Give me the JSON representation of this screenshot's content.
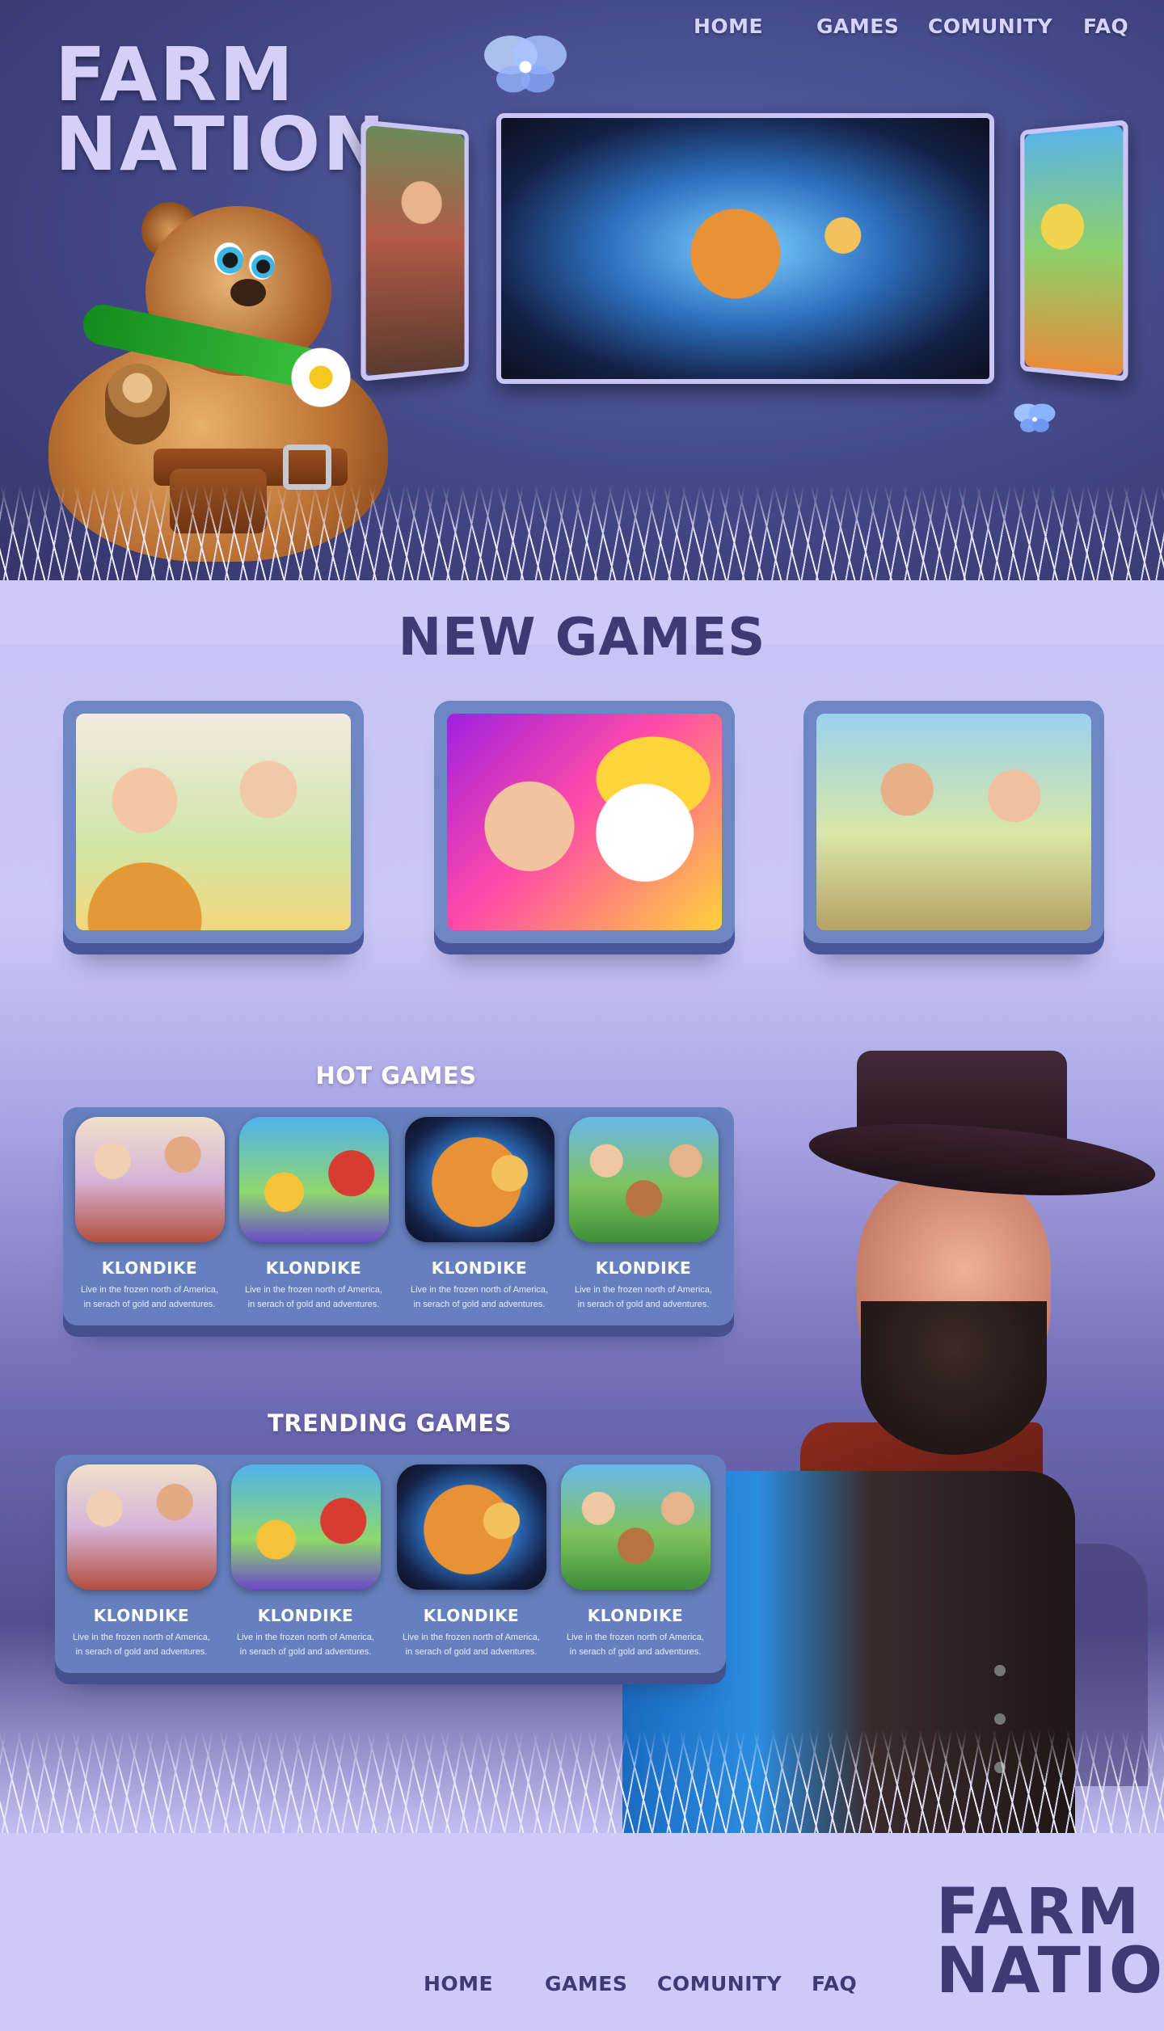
{
  "brand": {
    "line1": "FARM",
    "line2": "NATION"
  },
  "nav": {
    "home": "HOME",
    "games": "GAMES",
    "community": "COMUNITY",
    "faq": "FAQ"
  },
  "new_games": {
    "title": "NEW GAMES"
  },
  "hot_games": {
    "title": "HOT GAMES",
    "items": [
      {
        "name": "KLONDIKE",
        "desc_line1": "Live in the frozen north of America,",
        "desc_line2": "in serach of gold and adventures."
      },
      {
        "name": "KLONDIKE",
        "desc_line1": "Live in the frozen north of America,",
        "desc_line2": "in serach of gold and adventures."
      },
      {
        "name": "KLONDIKE",
        "desc_line1": "Live in the frozen north of America,",
        "desc_line2": "in serach of gold and adventures."
      },
      {
        "name": "KLONDIKE",
        "desc_line1": "Live in the frozen north of America,",
        "desc_line2": "in serach of gold and adventures."
      }
    ]
  },
  "trending_games": {
    "title": "TRENDING GAMES",
    "items": [
      {
        "name": "KLONDIKE",
        "desc_line1": "Live in the frozen north of America,",
        "desc_line2": "in serach of gold and adventures."
      },
      {
        "name": "KLONDIKE",
        "desc_line1": "Live in the frozen north of America,",
        "desc_line2": "in serach of gold and adventures."
      },
      {
        "name": "KLONDIKE",
        "desc_line1": "Live in the frozen north of America,",
        "desc_line2": "in serach of gold and adventures."
      },
      {
        "name": "KLONDIKE",
        "desc_line1": "Live in the frozen north of America,",
        "desc_line2": "in serach of gold and adventures."
      }
    ]
  },
  "footer": {
    "nav": {
      "home": "HOME",
      "games": "GAMES",
      "community": "COMUNITY",
      "faq": "FAQ"
    },
    "brand": {
      "line1": "FARM",
      "line2": "NATION"
    }
  },
  "colors": {
    "header_bg": "#434785",
    "lilac": "#cdc9f8",
    "panel_blue": "#6680bf",
    "title_dark": "#3d3b74",
    "nav_text": "#d6d3ff"
  },
  "icons": [
    "butterfly-icon"
  ]
}
